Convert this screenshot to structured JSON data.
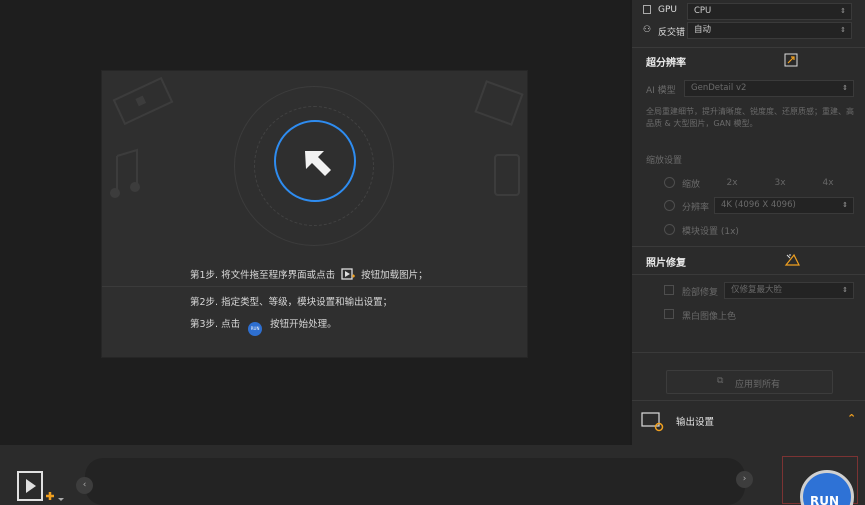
{
  "drop_zone": {
    "step1_before": "第1步. 将文件拖至程序界面或点击",
    "step1_after": "按钮加载图片；",
    "step2": "第2步. 指定类型、等级，模块设置和输出设置；",
    "step3_before": "第3步. 点击",
    "step3_after": "按钮开始处理。",
    "run_icon_text": "RUN"
  },
  "settings": {
    "gpu_label": "GPU",
    "gpu_value": "CPU",
    "anti_aliasing_label": "反交错",
    "anti_aliasing_value": "自动",
    "super_res_title": "超分辨率",
    "ai_model_label": "AI 模型",
    "ai_model_value": "GenDetail v2",
    "ai_model_desc": "全局重建细节，提升清晰度、锐度度、还原质感；重建、高品质 & 大型图片，GAN 模型。",
    "scale_label": "缩放设置",
    "zoom_label": "缩放",
    "scale_options": [
      "2x",
      "3x",
      "4x"
    ],
    "resolution_label": "分辨率",
    "resolution_value": "4K (4096 X 4096)",
    "tile_label": "模块设置 (1x)",
    "photo_repair_title": "照片修复",
    "face_repair_label": "脸部修复",
    "face_repair_value": "仅修复最大脸",
    "colorize_label": "黑白图像上色",
    "apply_all_label": "应用到所有",
    "output_settings_label": "输出设置"
  },
  "bottom": {
    "run_label": "RUN"
  },
  "colors": {
    "accent_blue": "#2e8cf0",
    "accent_orange": "#f0a020"
  }
}
